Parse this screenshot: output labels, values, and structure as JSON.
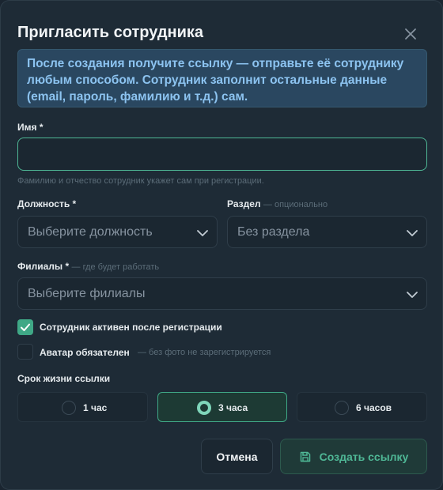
{
  "dialog": {
    "title": "Пригласить сотрудника",
    "notice": "После создания получите ссылку — отправьте её сотруднику любым способом. Сотрудник заполнит остальные данные (email, пароль, фамилию и т.д.) сам."
  },
  "name_field": {
    "label": "Имя *",
    "value": "",
    "hint": "Фамилию и отчество сотрудник укажет сам при регистрации."
  },
  "position_field": {
    "label": "Должность *",
    "placeholder": "Выберите должность"
  },
  "section_field": {
    "label": "Раздел",
    "optional_note": "— опционально",
    "value": "Без раздела"
  },
  "branches_field": {
    "label": "Филиалы *",
    "note": "— где будет работать",
    "placeholder": "Выберите филиалы"
  },
  "options": {
    "active_after_registration": {
      "label": "Сотрудник активен после регистрации",
      "checked": true
    },
    "avatar_required": {
      "label": "Аватар обязателен",
      "hint": "— без фото не зарегистрируется",
      "checked": false
    }
  },
  "link_ttl": {
    "label": "Срок жизни ссылки",
    "choices": [
      "1 час",
      "3 часа",
      "6 часов"
    ],
    "selected": "3 часа"
  },
  "footer": {
    "cancel_label": "Отмена",
    "submit_label": "Создать ссылку"
  },
  "colors": {
    "accent": "#3fa886",
    "notice_bg": "#2a4760",
    "notice_text": "#8cc3f0",
    "panel_bg": "#1e2b36"
  }
}
